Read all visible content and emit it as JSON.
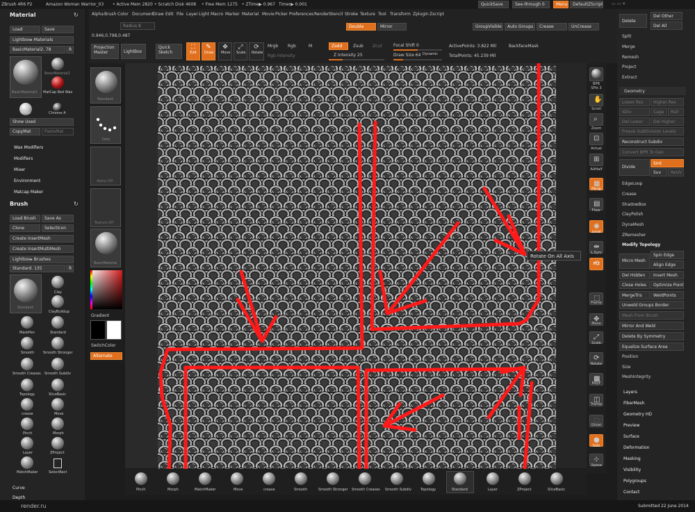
{
  "title_bar": {
    "app": "ZBrush 4R6 P2",
    "document": "Amazon Woman Warrior_03",
    "active_mem": "• Active Mem 2820",
    "scratch_disk": "• Scratch Disk 4608",
    "free_mem": "• Free Mem 1275",
    "ztime": "• ZTime▶ 0.967",
    "timer": "Timer▶ 0.001",
    "quicksave": "QuickSave",
    "see_through": "See-through  0",
    "menus": "Menus",
    "default_script": "DefaultZScript"
  },
  "menu_bar": [
    "Alpha",
    "Brush",
    "Color",
    "Document",
    "Draw",
    "Edit",
    "File",
    "Layer",
    "Light",
    "Macro",
    "Marker",
    "Material",
    "Movie",
    "Picker",
    "Preferences",
    "Render",
    "Stencil",
    "Stroke",
    "Texture",
    "Tool",
    "Transform",
    "Zplugin",
    "Zscript"
  ],
  "top_shelf": {
    "radius": "Radius 8",
    "double": "Double",
    "mirror": "Mirror",
    "group_visible": "GroupVisible",
    "auto_groups": "Auto Groups",
    "crease": "Crease",
    "uncrease": "UnCrease",
    "coords": "0.946,0.798,0.487",
    "projection_master": "Projection Master",
    "lightbox": "LightBox",
    "quick_sketch": "Quick Sketch",
    "edit": "Edit",
    "draw": "Draw",
    "move": "Move",
    "scale": "Scale",
    "rotate": "Rotate",
    "mrgb": "Mrgb",
    "rgb": "Rgb",
    "m": "M",
    "rgb_intensity": "Rgb Intensity",
    "zadd": "Zadd",
    "zsub": "Zsub",
    "zcut": "Zcut",
    "z_intensity": "Z Intensity 25",
    "focal_shift": "Focal Shift 0",
    "draw_size": "Draw Size 64",
    "dynamic": "Dynamic",
    "active_points": "ActivePoints: 3.822 Mil",
    "total_points": "TotalPoints: 45.239 Mil",
    "backface_mask": "BackfaceMask"
  },
  "left_panel": {
    "material_header": "Material",
    "load": "Load",
    "save": "Save",
    "lightbox_materials": "Lightbox▸ Materials",
    "basic_material": "BasicMaterial2. 78",
    "r": "R",
    "materials": [
      "BasicMaterial2",
      "MatCap Red Wax",
      "Chalk",
      "Chrome A"
    ],
    "show_used": "Show Used",
    "copy_mat": "CopyMat",
    "paste_mat": "PasteMat",
    "sections": [
      "Wax Modifiers",
      "Modifiers",
      "Mixer",
      "Environment",
      "Matcap Maker"
    ],
    "brush_header": "Brush",
    "load_brush": "Load Brush",
    "save_as": "Save As",
    "clone": "Clone",
    "select_icon": "SelectIcon",
    "create_insertmesh": "Create InsertMesh",
    "create_insertmultimesh": "Create InsertMultiMesh",
    "lightbox_brushes": "Lightbox▸ Brushes",
    "standard": "Standard. 135",
    "brushes": [
      "Standard",
      "Clay",
      "ClayBuildup",
      "MaskPen",
      "Standard",
      "Smooth",
      "Smooth Stronger",
      "Smooth Creases",
      "Smooth Subdiv",
      "Topology",
      "SliceBasic",
      "crease",
      "Move",
      "Pinch",
      "Morph",
      "Layer",
      "ZProject",
      "MatchMaker",
      "SelectRect"
    ],
    "curve": "Curve",
    "depth": "Depth"
  },
  "left_strip": {
    "standard": "Standard",
    "dots": "Dots",
    "alpha_off": "Alpha Off",
    "texture_off": "Texture Off",
    "basic_material": "BasicMaterial",
    "gradient": "Gradient",
    "switch_color": "SwitchColor",
    "alternate": "Alternate"
  },
  "right_tools": [
    "BPR",
    "SPix 3",
    "Scroll",
    "Zoom",
    "Actual",
    "AAHalf",
    "Persp",
    "Floor",
    "Local",
    "L.Sym",
    "XYZ",
    "Frame",
    "Move",
    "Scale",
    "Rotate",
    "PolyF",
    "Transp",
    "Ghost",
    "Solo",
    "Xpose"
  ],
  "tooltip": "Rotate On All Axis",
  "right_panel": {
    "delete": "Delete",
    "del_other": "Del Other",
    "del_all": "Del All",
    "split": "Split",
    "merge": "Merge",
    "remesh": "Remesh",
    "project": "Project",
    "extract": "Extract",
    "geometry": "Geometry",
    "lower_res": "Lower Res",
    "higher_res": "Higher Res",
    "sdiv": "SDiv",
    "cage": "Cage",
    "rstr": "Rstr",
    "del_lower": "Del Lower",
    "del_higher": "Del Higher",
    "freeze_subdivision_levels": "Freeze SubDivision Levels",
    "reconstruct_subdiv": "Reconstruct Subdiv",
    "convert_bpr": "Convert BPR To Geo",
    "divide": "Divide",
    "smt": "Smt",
    "suv": "Suv",
    "reuv": "ReUV",
    "tools": [
      "EdgeLoop",
      "Crease",
      "ShadowBox",
      "ClayPolish",
      "DynaMesh",
      "ZRemesher"
    ],
    "modify_topology": "Modify Topology",
    "micro_mesh": "Micro Mesh",
    "spin_edge": "Spin Edge",
    "align_edge": "Align Edge",
    "del_hidden": "Del Hidden",
    "insert_mesh": "Insert Mesh",
    "close_holes": "Close Holes",
    "optimize_points": "Optimize Points",
    "merge_tris": "MergeTris",
    "weld_points": "WeldPoints",
    "unweld_groups_border": "Unweld Groups Border",
    "mesh_from_brush": "Mesh From Brush",
    "mirror_and_weld": "Mirror And Weld",
    "delete_by_symmetry": "Delete By Symmetry",
    "equalize_surface_area": "Equalize Surface Area",
    "position": "Position",
    "size": "Size",
    "mesh_integrity": "MeshIntegrity",
    "sections": [
      "Layers",
      "FiberMesh",
      "Geometry HD",
      "Preview",
      "Surface",
      "Deformation",
      "Masking",
      "Visibility",
      "Polygroups",
      "Contact"
    ]
  },
  "bottom_shelf": [
    "Pinch",
    "Morph",
    "MatchMaker",
    "Move",
    "crease",
    "Smooth",
    "Smooth Stronger",
    "Smooth Creases",
    "Smooth Subdiv",
    "Topology",
    "Standard",
    "Layer",
    "ZProject",
    "SliceBasic"
  ],
  "footer": {
    "watermark": "render.ru",
    "submitted": "Submitted 22 June 2014"
  }
}
